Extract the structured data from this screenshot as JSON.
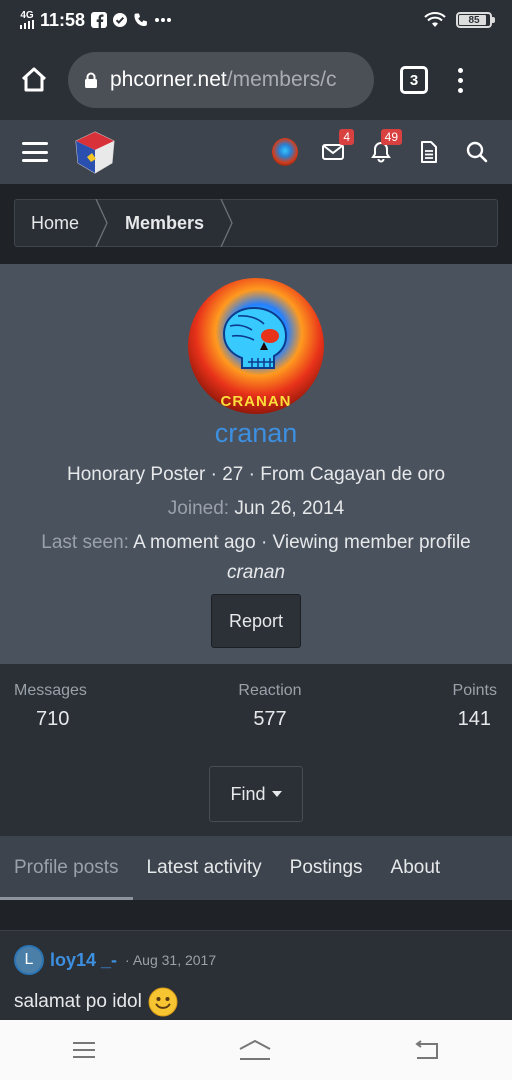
{
  "status_bar": {
    "network": "4G",
    "time": "11:58",
    "battery_level": "85"
  },
  "browser": {
    "url_host": "phcorner.net",
    "url_path": "/members/c",
    "tab_count": "3"
  },
  "header": {
    "inbox_badge": "4",
    "alerts_badge": "49"
  },
  "breadcrumb": {
    "items": [
      "Home",
      "Members"
    ]
  },
  "profile": {
    "avatar_text": "CRANAN",
    "username": "cranan",
    "info_line": "Honorary Poster · 27 · From Cagayan de oro",
    "joined_label": "Joined:",
    "joined_value": "Jun 26, 2014",
    "last_seen_label": "Last seen:",
    "last_seen_value": "A moment ago · Viewing member profile",
    "viewing_user": "cranan",
    "report_label": "Report"
  },
  "stats": {
    "messages_label": "Messages",
    "messages_value": "710",
    "reaction_label": "Reaction",
    "reaction_value": "577",
    "points_label": "Points",
    "points_value": "141",
    "find_label": "Find"
  },
  "tabs": [
    "Profile posts",
    "Latest activity",
    "Postings",
    "About"
  ],
  "post": {
    "avatar_letter": "L",
    "user": "loy14 _-",
    "date": "Aug 31, 2017",
    "text": "salamat po idol"
  },
  "colors": {
    "accent_link": "#3d8fe0",
    "badge_red": "#d94040",
    "card_bg": "#4a525e"
  }
}
